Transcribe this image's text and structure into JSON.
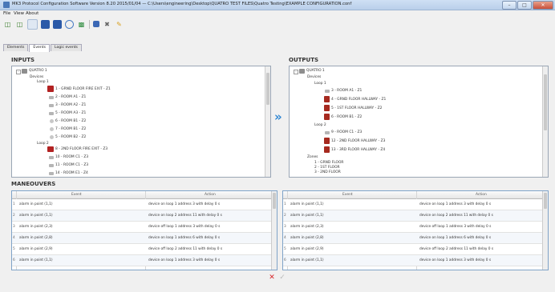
{
  "window": {
    "title": "MK3 Protocol Configuration Software Version 8.20 2015/01/04 — C:\\Users\\engineering\\Desktop\\QUATRO TEST FILES\\Quatro Testing\\EXAMPLE CONFIGURATION.conf",
    "minimize": "–",
    "maximize": "□",
    "close": "✕"
  },
  "menu": {
    "file": "File",
    "view": "View",
    "about": "About"
  },
  "toolbar": {
    "icons": [
      "open-file",
      "save-all",
      "new-file",
      "save",
      "save-as",
      "connect",
      "chart",
      "cpu",
      "config",
      "tools"
    ]
  },
  "tabs": {
    "elements": "Elements",
    "events": "Events",
    "logic_events": "Logic events"
  },
  "inputs": {
    "label": "INPUTS",
    "root": "QUATRO 1",
    "devices": "Devices",
    "loop1": "Loop 1",
    "loop1_items": [
      "1 - GRND FLOOR FIRE EXIT - Z1",
      "2 - ROOM A1 - Z1",
      "3 - ROOM A2 - Z1",
      "5 - ROOM A3 - Z1",
      "6 - ROOM B1 - Z2",
      "7 - ROOM B1 - Z2",
      "5 - ROOM B2 - Z2"
    ],
    "loop2": "Loop 2",
    "loop2_items": [
      "8 - 2ND FLOOR FIRE EXIT - Z3",
      "10 - ROOM C1 - Z3",
      "11 - ROOM C1 - Z3",
      "14 - ROOM E1 - Z4"
    ]
  },
  "outputs": {
    "label": "OUTPUTS",
    "root": "QUATRO 1",
    "devices": "Devices",
    "loop1": "Loop 1",
    "loop1_items": [
      "3 - ROOM A1 - Z1",
      "4 - GRND FLOOR HALLWAY - Z1",
      "5 - 1ST FLOOR HALLWAY - Z2",
      "6 - ROOM B1 - Z2"
    ],
    "loop2": "Loop 2",
    "loop2_items": [
      "9 - ROOM C1 - Z3",
      "12 - 2ND FLOOR HALLWAY - Z3",
      "13 - 3RD FLOOR HALLWAY - Z4"
    ],
    "zones": "Zones",
    "zone_items": [
      "1 - GRND FLOOR",
      "2 - 1ST FLOOR",
      "3 - 2ND FLOOR"
    ]
  },
  "transfer": "»",
  "maneouvers": {
    "label": "MANEOUVERS",
    "headers": {
      "event": "Event",
      "action": "Action"
    },
    "left_rows": [
      {
        "num": "1",
        "event": "alarm in point (1,1)",
        "action": "device on loop 1 address 3  with delay 0 s"
      },
      {
        "num": "2",
        "event": "alarm in point (1,1)",
        "action": "device on loop 2 address 11  with delay 0 s"
      },
      {
        "num": "3",
        "event": "alarm in point (2,3)",
        "action": "device off loop 1 address 3  with delay 0 s"
      },
      {
        "num": "4",
        "event": "alarm in point (2,8)",
        "action": "device on loop 1 address 6  with delay 0 s"
      },
      {
        "num": "5",
        "event": "alarm in point (2,9)",
        "action": "device off loop 2 address 11  with delay 0 s"
      },
      {
        "num": "6",
        "event": "alarm in point (1,1)",
        "action": "device on loop 1 address 3  with delay 0 s"
      }
    ],
    "right_rows": [
      {
        "num": "1",
        "event": "alarm in point (1,1)",
        "action": "device on loop 1 address 3  with delay 0 s"
      },
      {
        "num": "2",
        "event": "alarm in point (1,1)",
        "action": "device on loop 2 address 11  with delay 0 s"
      },
      {
        "num": "3",
        "event": "alarm in point (2,3)",
        "action": "device off loop 1 address 3  with delay 0 s"
      },
      {
        "num": "4",
        "event": "alarm in point (2,8)",
        "action": "device on loop 1 address 6  with delay 0 s"
      },
      {
        "num": "5",
        "event": "alarm in point (2,9)",
        "action": "device off loop 2 address 11  with delay 0 s"
      },
      {
        "num": "6",
        "event": "alarm in point (1,1)",
        "action": "device on loop 1 address 3  with delay 0 s"
      }
    ]
  },
  "bottom": {
    "delete": "✕",
    "confirm": "✓"
  },
  "colors": {
    "accent": "#2f86d3",
    "selected": "#b22222",
    "device_red": "#a62a1f"
  }
}
